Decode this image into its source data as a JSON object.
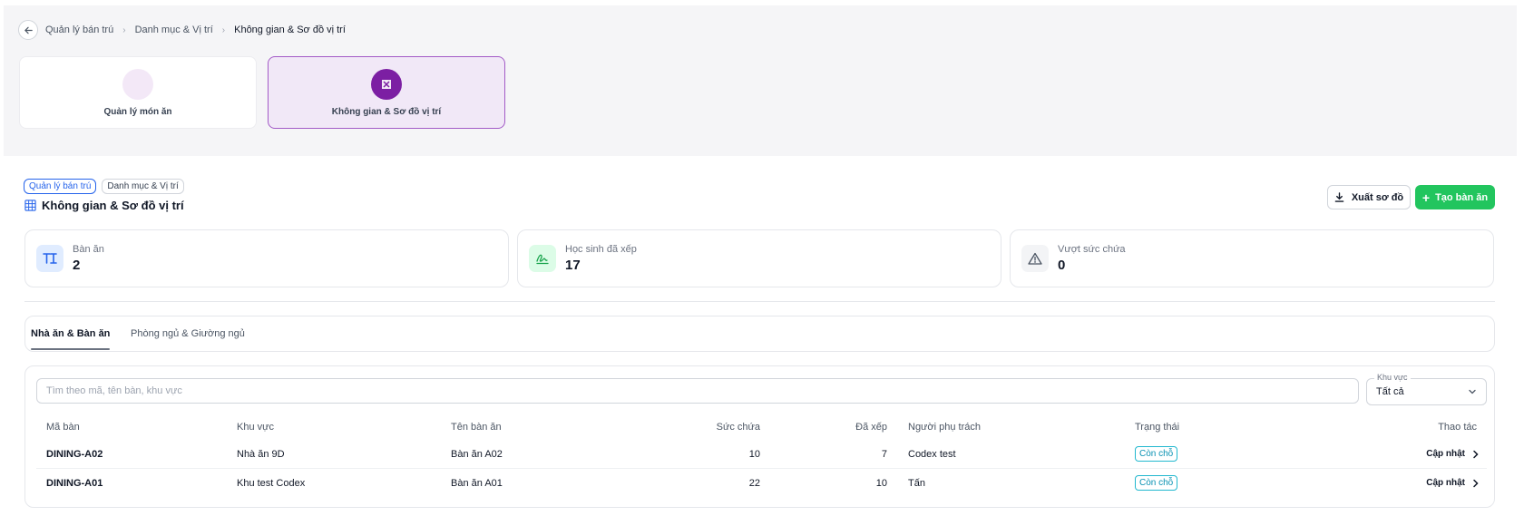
{
  "breadcrumb": {
    "items": [
      "Quản lý bán trú",
      "Danh mục & Vị trí",
      "Không gian & Sơ đồ vị trí"
    ]
  },
  "modules": [
    {
      "label": "Quản lý món ăn",
      "active": false
    },
    {
      "label": "Không gian & Sơ đồ vị trí",
      "active": true
    }
  ],
  "header": {
    "tags": [
      "Quản lý bán trú",
      "Danh mục & Vị trí"
    ],
    "title": "Không gian & Sơ đồ vị trí",
    "export_label": "Xuất sơ đồ",
    "create_label": "Tạo bàn ăn"
  },
  "stats": [
    {
      "label": "Bàn ăn",
      "value": "2",
      "icon": "table-icon"
    },
    {
      "label": "Học sinh đã xếp",
      "value": "17",
      "icon": "signature-icon"
    },
    {
      "label": "Vượt sức chứa",
      "value": "0",
      "icon": "warning-icon"
    }
  ],
  "tabs": [
    {
      "label": "Nhà ăn & Bàn ăn",
      "active": true
    },
    {
      "label": "Phòng ngủ & Giường ngủ",
      "active": false
    }
  ],
  "filters": {
    "search_placeholder": "Tìm theo mã, tên bàn, khu vực",
    "area_label": "Khu vực",
    "area_value": "Tất cả"
  },
  "table": {
    "columns": [
      "Mã bàn",
      "Khu vực",
      "Tên bàn ăn",
      "Sức chứa",
      "Đã xếp",
      "Người phụ trách",
      "Trạng thái",
      "Thao tác"
    ],
    "rows": [
      {
        "code": "DINING-A02",
        "area": "Nhà ăn 9D",
        "name": "Bàn ăn A02",
        "capacity": "10",
        "assigned": "7",
        "owner": "Codex test",
        "status": "Còn chỗ",
        "action": "Cập nhật"
      },
      {
        "code": "DINING-A01",
        "area": "Khu test Codex",
        "name": "Bàn ăn A01",
        "capacity": "22",
        "assigned": "10",
        "owner": "Tấn",
        "status": "Còn chỗ",
        "action": "Cập nhật"
      }
    ]
  },
  "colors": {
    "primary_purple": "#7c1fa3",
    "success_green": "#22c55e",
    "status_cyan": "#22b8cf",
    "link_blue": "#2563eb"
  }
}
